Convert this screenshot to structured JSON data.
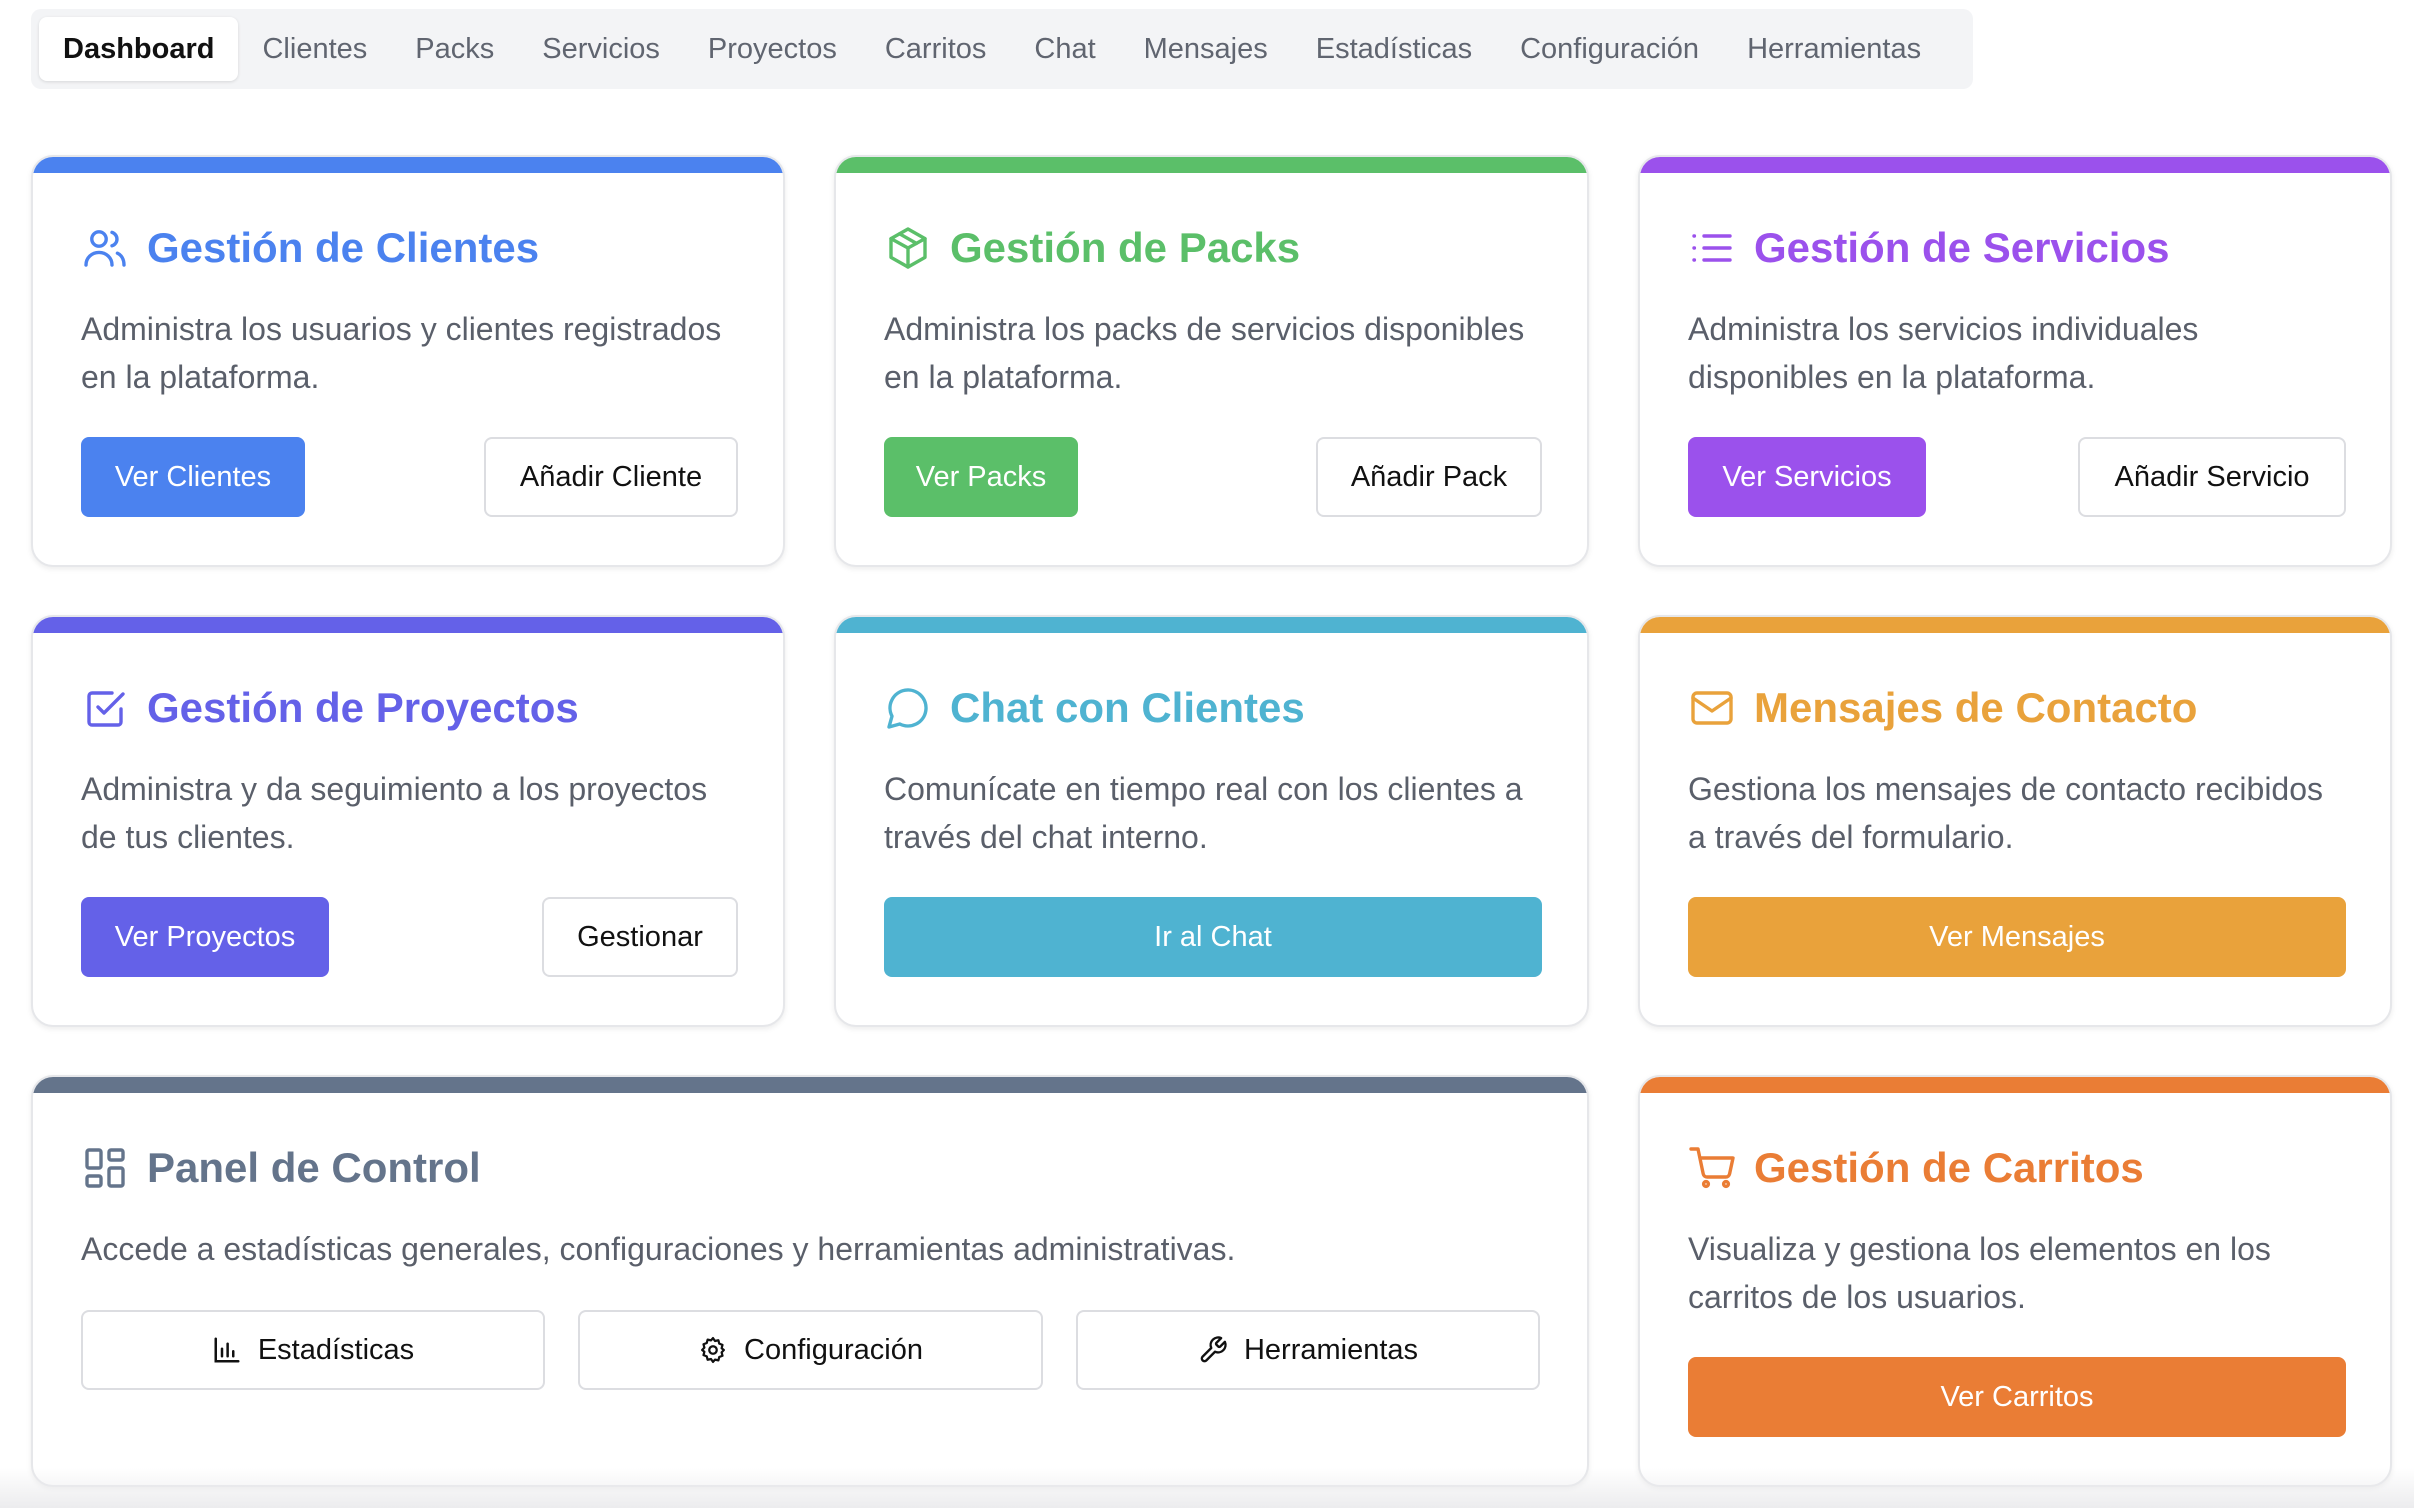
{
  "tabs": [
    "Dashboard",
    "Clientes",
    "Packs",
    "Servicios",
    "Proyectos",
    "Carritos",
    "Chat",
    "Mensajes",
    "Estadísticas",
    "Configuración",
    "Herramientas"
  ],
  "active_tab": "Dashboard",
  "cards": {
    "clientes": {
      "color": "#4b82ef",
      "icon": "users-icon",
      "title": "Gestión de Clientes",
      "description": "Administra los usuarios y clientes registrados en la plataforma.",
      "primary": "Ver Clientes",
      "secondary": "Añadir Cliente"
    },
    "packs": {
      "color": "#5bbf69",
      "icon": "package-icon",
      "title": "Gestión de Packs",
      "description": "Administra los packs de servicios disponibles en la plataforma.",
      "primary": "Ver Packs",
      "secondary": "Añadir Pack"
    },
    "servicios": {
      "color": "#9b51ec",
      "icon": "list-icon",
      "title": "Gestión de Servicios",
      "description": "Administra los servicios individuales disponibles en la plataforma.",
      "primary": "Ver Servicios",
      "secondary": "Añadir Servicio"
    },
    "proyectos": {
      "color": "#6461e8",
      "icon": "checkbox-icon",
      "title": "Gestión de Proyectos",
      "description": "Administra y da seguimiento a los proyectos de tus clientes.",
      "primary": "Ver Proyectos",
      "secondary": "Gestionar"
    },
    "chat": {
      "color": "#4fb3d1",
      "icon": "chat-bubble-icon",
      "title": "Chat con Clientes",
      "description": "Comunícate en tiempo real con los clientes a través del chat interno.",
      "primary": "Ir al Chat"
    },
    "mensajes": {
      "color": "#e9a23b",
      "icon": "mail-icon",
      "title": "Mensajes de Contacto",
      "description": "Gestiona los mensajes de contacto recibidos a través del formulario.",
      "primary": "Ver Mensajes"
    },
    "panel": {
      "color": "#64748b",
      "icon": "dashboard-grid-icon",
      "title": "Panel de Control",
      "description": "Accede a estadísticas generales, configuraciones y herramientas administrativas.",
      "buttons": [
        {
          "label": "Estadísticas",
          "icon": "bar-chart-icon"
        },
        {
          "label": "Configuración",
          "icon": "gear-icon"
        },
        {
          "label": "Herramientas",
          "icon": "wrench-icon"
        }
      ]
    },
    "carritos": {
      "color": "#ea7d35",
      "icon": "cart-icon",
      "title": "Gestión de Carritos",
      "description": "Visualiza y gestiona los elementos en los carritos de los usuarios.",
      "primary": "Ver Carritos"
    }
  }
}
